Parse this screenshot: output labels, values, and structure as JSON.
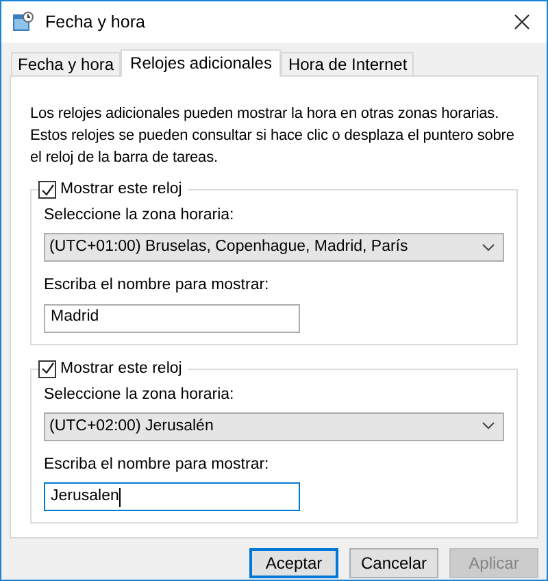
{
  "window": {
    "title": "Fecha y hora"
  },
  "tabs": [
    {
      "label": "Fecha y hora",
      "selected": false
    },
    {
      "label": "Relojes adicionales",
      "selected": true
    },
    {
      "label": "Hora de Internet",
      "selected": false
    }
  ],
  "description": "Los relojes adicionales pueden mostrar la hora en otras zonas horarias. Estos relojes se pueden consultar si hace clic o desplaza el puntero sobre el reloj de la barra de tareas.",
  "clocks": [
    {
      "show_label": "Mostrar este reloj",
      "checked": true,
      "zone_label": "Seleccione la zona horaria:",
      "zone": "(UTC+01:00) Bruselas, Copenhague, Madrid, París",
      "name_label": "Escriba el nombre para mostrar:",
      "name": "Madrid",
      "focused": false
    },
    {
      "show_label": "Mostrar este reloj",
      "checked": true,
      "zone_label": "Seleccione la zona horaria:",
      "zone": "(UTC+02:00) Jerusalén",
      "name_label": "Escriba el nombre para mostrar:",
      "name": "Jerusalen",
      "focused": true
    }
  ],
  "buttons": [
    {
      "label": "Aceptar",
      "default": true,
      "disabled": false
    },
    {
      "label": "Cancelar",
      "default": false,
      "disabled": false
    },
    {
      "label": "Aplicar",
      "default": false,
      "disabled": true
    }
  ]
}
